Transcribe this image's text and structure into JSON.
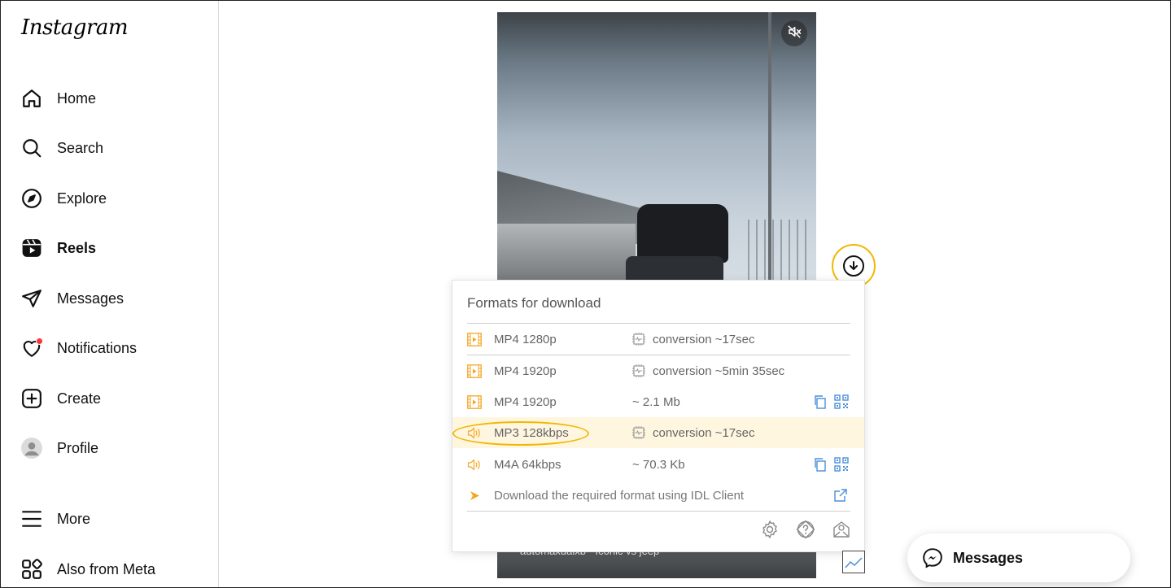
{
  "app": {
    "logo_text": "Instagram"
  },
  "sidebar": {
    "items": [
      {
        "label": "Home",
        "icon": "home-icon"
      },
      {
        "label": "Search",
        "icon": "search-icon"
      },
      {
        "label": "Explore",
        "icon": "compass-icon"
      },
      {
        "label": "Reels",
        "icon": "reels-icon",
        "active": true
      },
      {
        "label": "Messages",
        "icon": "paper-plane-icon"
      },
      {
        "label": "Notifications",
        "icon": "heart-icon"
      },
      {
        "label": "Create",
        "icon": "plus-square-icon"
      },
      {
        "label": "Profile",
        "icon": "avatar-icon"
      }
    ],
    "more_label": "More",
    "meta_label": "Also from Meta"
  },
  "reel": {
    "caption": "automaxualxb · Iconic vs jeep"
  },
  "download_popup": {
    "title": "Formats for download",
    "formats": [
      {
        "name": "MP4 1280p",
        "info": "conversion ~17sec",
        "type": "video"
      },
      {
        "name": "MP4 1920p",
        "info": "conversion ~5min 35sec",
        "type": "video"
      },
      {
        "name": "MP4 1920p",
        "info": "~ 2.1 Mb",
        "type": "video"
      },
      {
        "name": "MP3 128kbps",
        "info": "conversion ~17sec",
        "type": "audio",
        "highlighted": true
      },
      {
        "name": "M4A 64kbps",
        "info": "~ 70.3 Kb",
        "type": "audio"
      }
    ],
    "idl_text": "Download the required format using IDL Client"
  },
  "messages_pill": {
    "label": "Messages"
  },
  "colors": {
    "accent": "#f2b705",
    "icon_orange": "#f5a623",
    "link_blue": "#4a90d9",
    "notif_red": "#ff3040"
  }
}
